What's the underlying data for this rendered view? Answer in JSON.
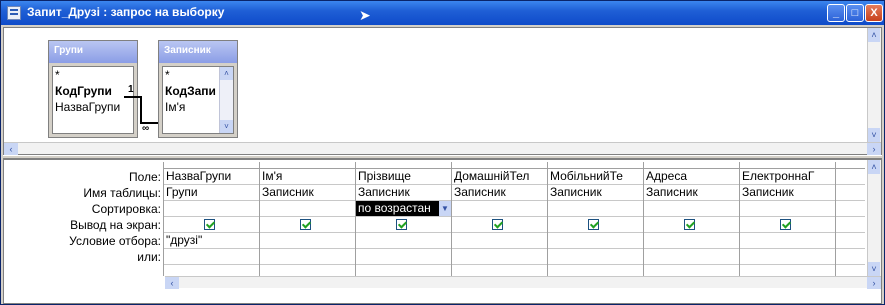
{
  "window": {
    "title": "Запит_Друзі : запрос на выборку",
    "minimize_glyph": "_",
    "maximize_glyph": "□",
    "close_glyph": "X"
  },
  "tables": [
    {
      "name": "Групи",
      "fields": [
        "*",
        "КодГрупи",
        "НазваГрупи"
      ],
      "key_index": 1
    },
    {
      "name": "Записник",
      "fields": [
        "*",
        "КодЗапи",
        "Ім'я"
      ],
      "key_index": 1
    }
  ],
  "relationship": {
    "one": "1",
    "many": "∞"
  },
  "grid": {
    "row_labels": [
      "Поле:",
      "Имя таблицы:",
      "Сортировка:",
      "Вывод на экран:",
      "Условие отбора:",
      "или:"
    ],
    "columns": [
      {
        "field": "НазваГрупи",
        "table": "Групи",
        "sort": "",
        "show": true,
        "criteria": "\"друзі\"",
        "or": ""
      },
      {
        "field": "Ім'я",
        "table": "Записник",
        "sort": "",
        "show": true,
        "criteria": "",
        "or": ""
      },
      {
        "field": "Прізвище",
        "table": "Записник",
        "sort": "по возрастан",
        "show": true,
        "criteria": "",
        "or": ""
      },
      {
        "field": "ДомашнійТел",
        "table": "Записник",
        "sort": "",
        "show": true,
        "criteria": "",
        "or": ""
      },
      {
        "field": "МобільнийТе",
        "table": "Записник",
        "sort": "",
        "show": true,
        "criteria": "",
        "or": ""
      },
      {
        "field": "Адреса",
        "table": "Записник",
        "sort": "",
        "show": true,
        "criteria": "",
        "or": ""
      },
      {
        "field": "ЕлектроннаГ",
        "table": "Записник",
        "sort": "",
        "show": true,
        "criteria": "",
        "or": ""
      },
      {
        "field": "",
        "table": "",
        "sort": "",
        "show": false,
        "criteria": "",
        "or": ""
      }
    ]
  },
  "icons": {
    "scroll_left": "‹",
    "scroll_right": "›",
    "scroll_up": "˄",
    "scroll_down": "˅",
    "dropdown": "▼"
  }
}
